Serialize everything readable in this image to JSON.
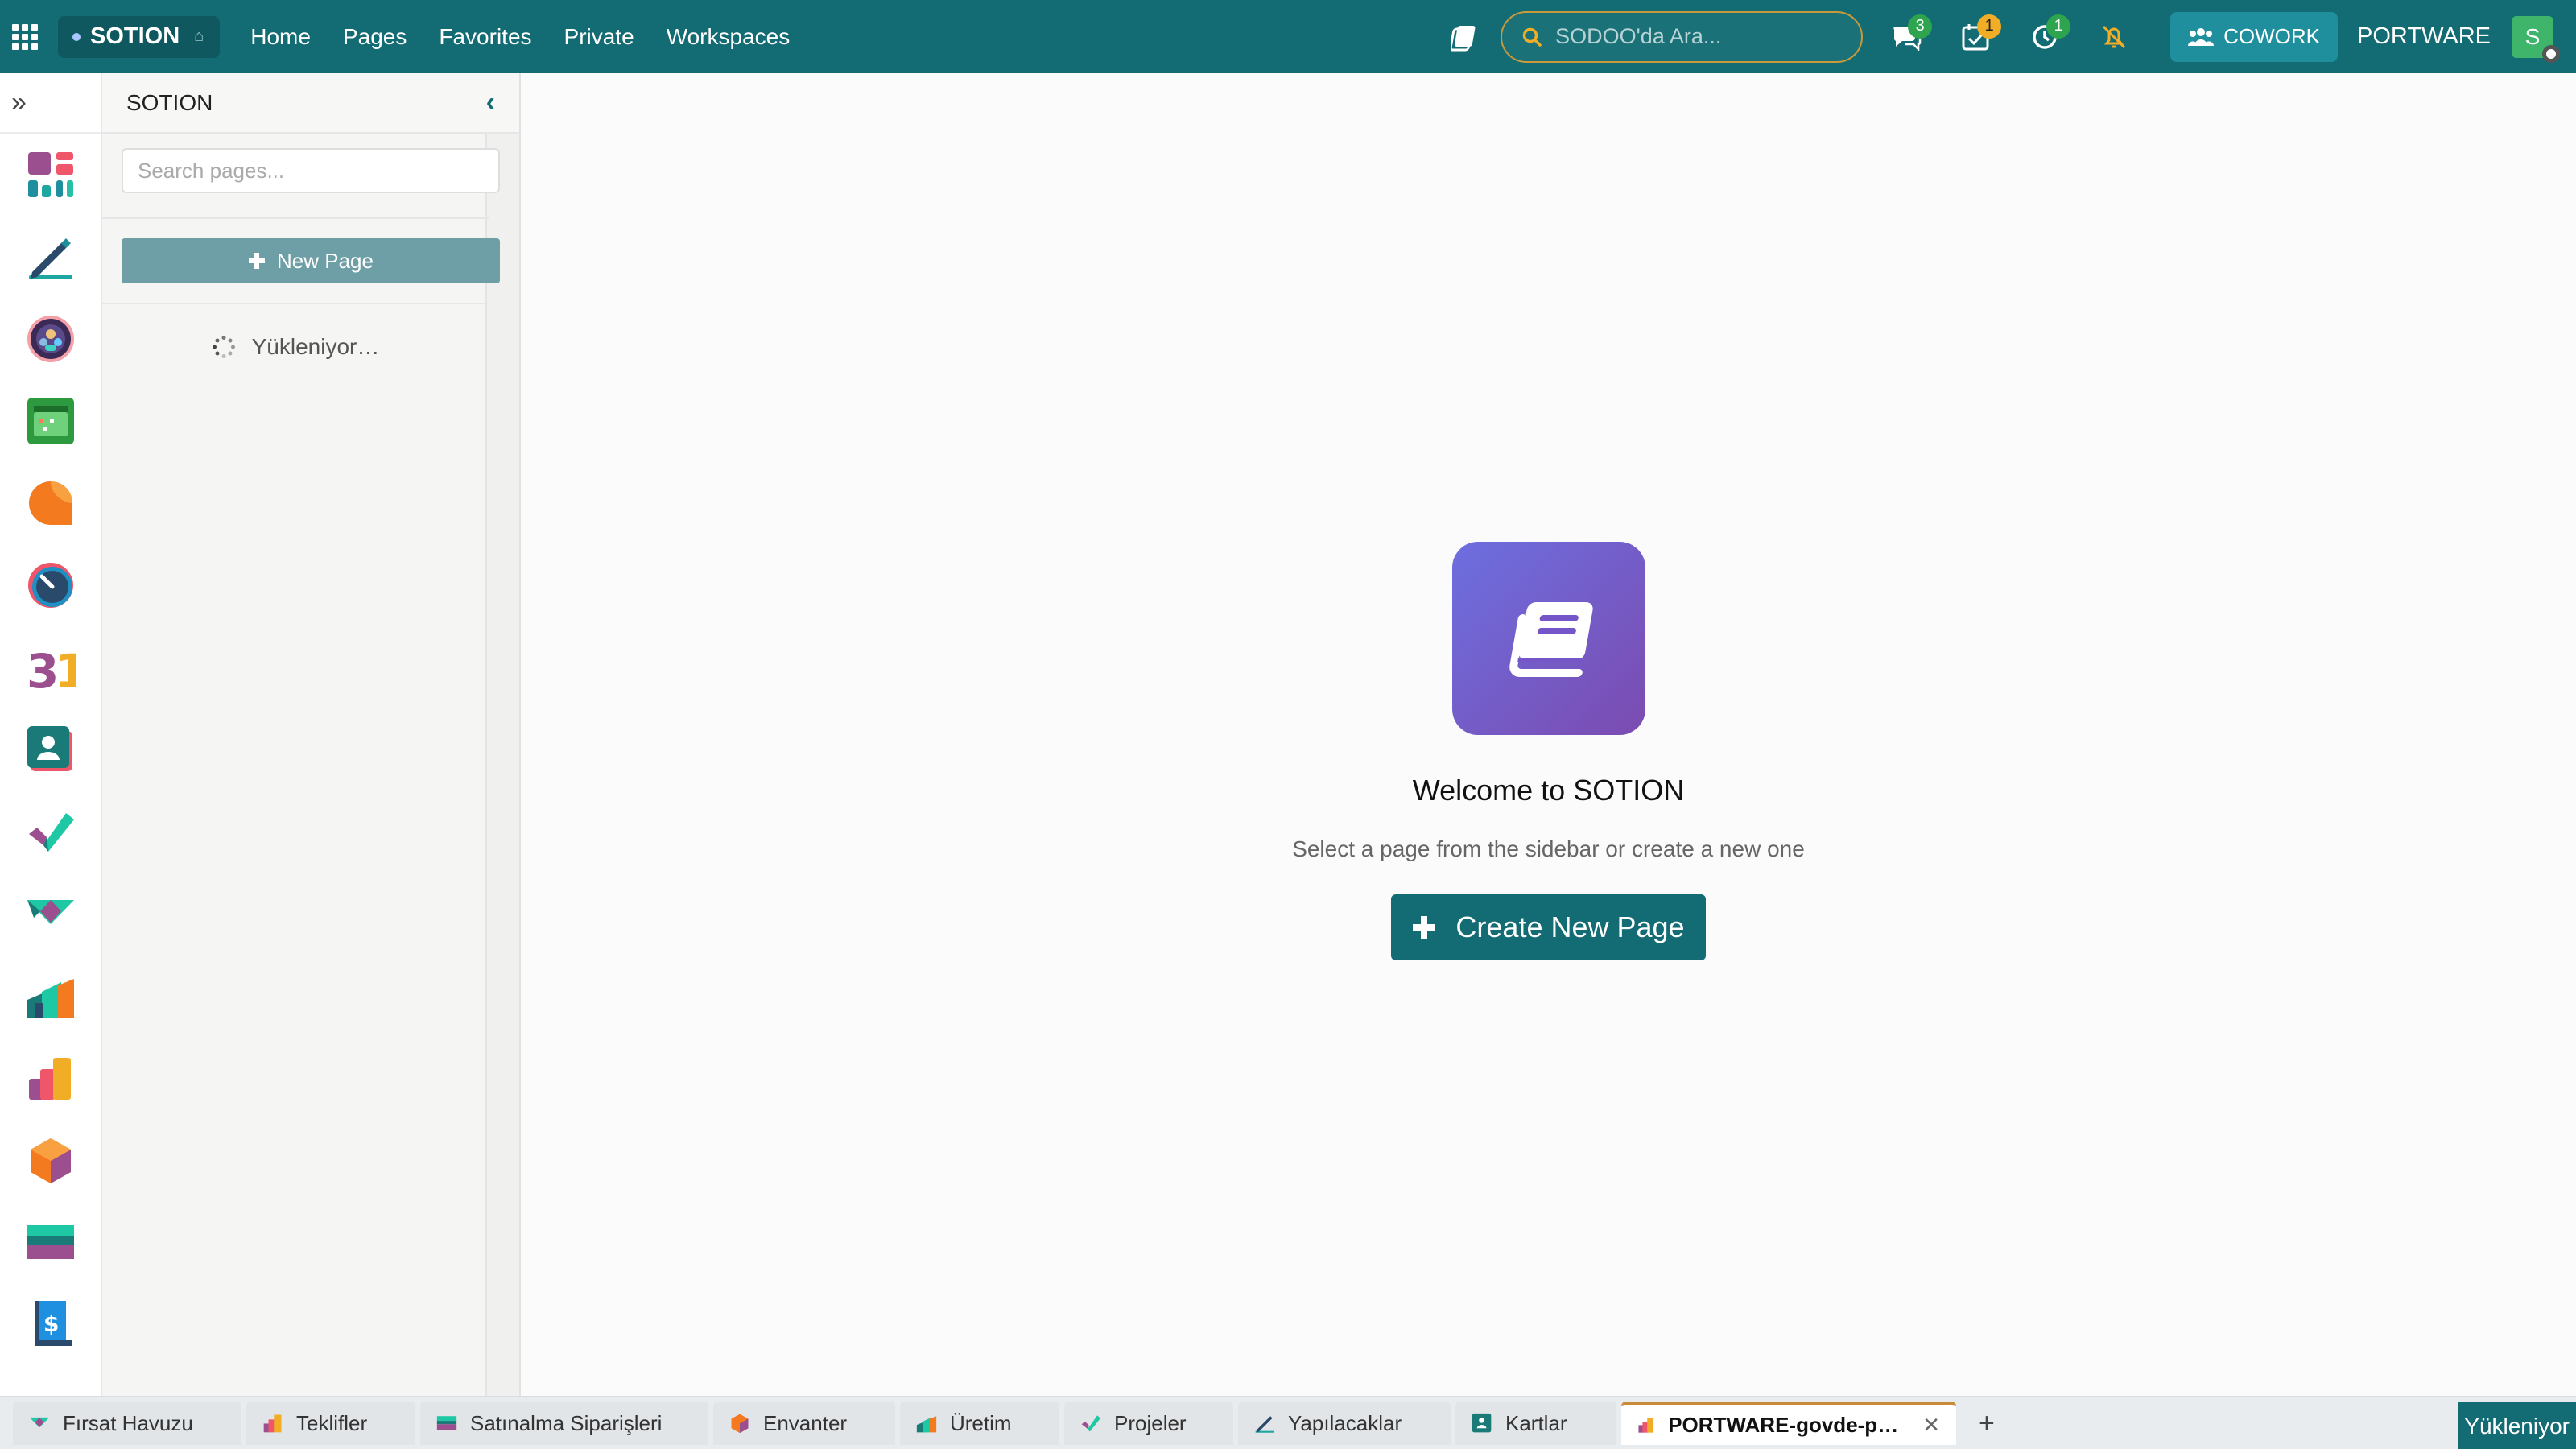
{
  "topbar": {
    "app_name": "SOTION",
    "nav": [
      "Home",
      "Pages",
      "Favorites",
      "Private",
      "Workspaces"
    ],
    "search_placeholder": "SODOO'da Ara...",
    "badges": {
      "messages": "3",
      "activities": "1",
      "timer": "1"
    },
    "cowork_label": "COWORK",
    "company": "PORTWARE",
    "avatar_initial": "S",
    "accent": "#136b73"
  },
  "rail": {
    "expand_icon": "»",
    "apps": [
      "dashboard-icon",
      "pen-icon",
      "team-icon",
      "calendar-icon",
      "discuss-icon",
      "speedometer-icon",
      "calendar-31-icon",
      "contacts-icon",
      "check-icon",
      "handshake-icon",
      "manufacturing-icon",
      "sales-icon",
      "inventory-icon",
      "purchase-icon",
      "invoice-icon"
    ]
  },
  "sidebar": {
    "title": "SOTION",
    "search_placeholder": "Search pages...",
    "new_page_label": "New Page",
    "loading_label": "Yükleniyor…"
  },
  "main": {
    "welcome_title": "Welcome to SOTION",
    "welcome_subtitle": "Select a page from the sidebar or create a new one",
    "create_label": "Create New Page",
    "hero_icon": "book-icon"
  },
  "tabs": [
    {
      "label": "Fırsat Havuzu",
      "icon": "handshake-icon"
    },
    {
      "label": "Teklifler",
      "icon": "sales-icon"
    },
    {
      "label": "Satınalma Siparişleri",
      "icon": "purchase-icon"
    },
    {
      "label": "Envanter",
      "icon": "inventory-icon"
    },
    {
      "label": "Üretim",
      "icon": "manufacturing-icon"
    },
    {
      "label": "Projeler",
      "icon": "check-icon"
    },
    {
      "label": "Yapılacaklar",
      "icon": "pen-icon"
    },
    {
      "label": "Kartlar",
      "icon": "contacts-icon"
    },
    {
      "label": "PORTWARE-govde-p…",
      "icon": "sales-icon",
      "active": true
    }
  ],
  "tab_add": "+",
  "status_label": "Yükleniyor"
}
